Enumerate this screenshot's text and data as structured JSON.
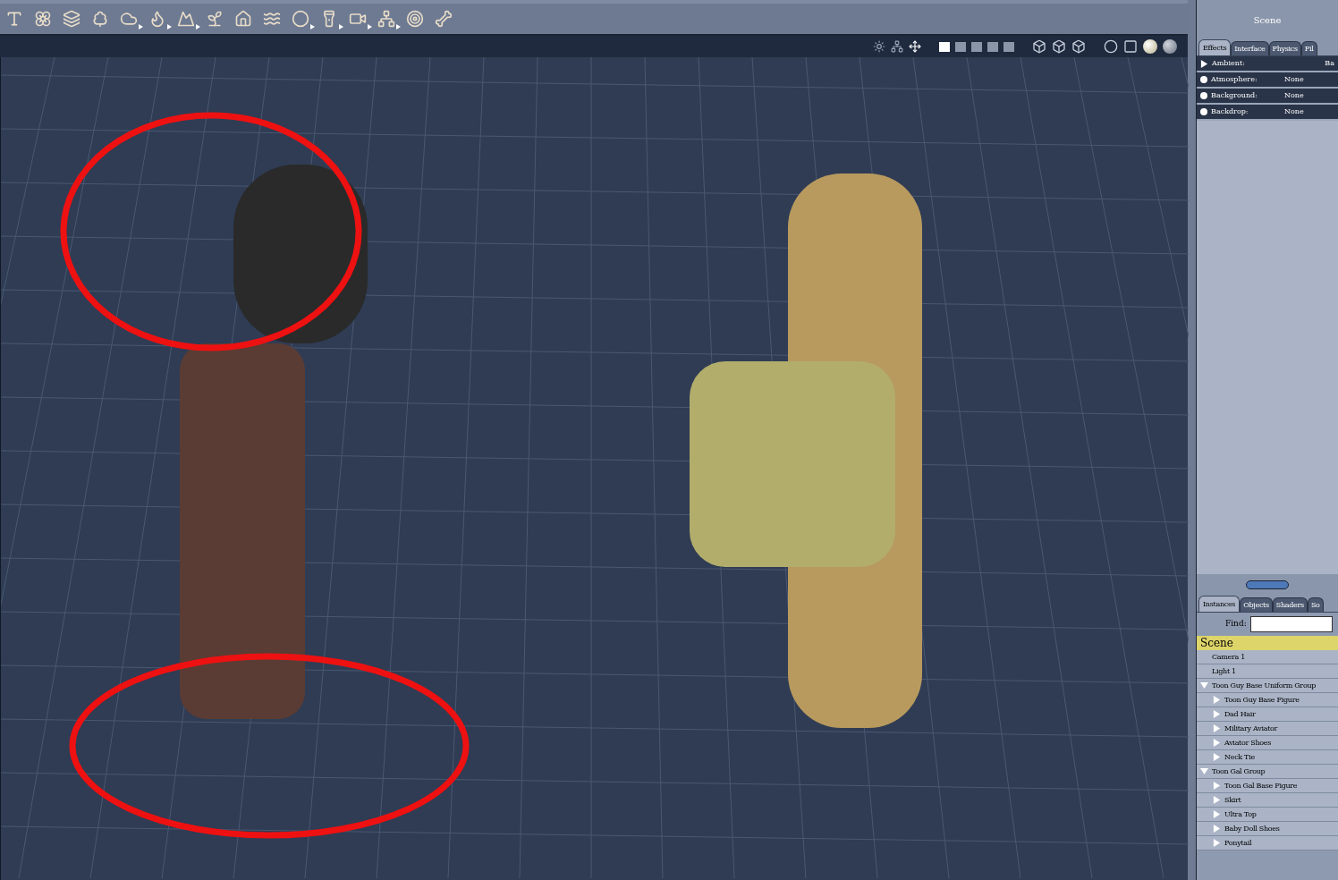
{
  "toolbar": {
    "tools": [
      {
        "menu": false
      },
      {
        "menu": false
      },
      {
        "menu": false
      },
      {
        "menu": false
      },
      {
        "menu": true
      },
      {
        "menu": true
      },
      {
        "menu": true
      },
      {
        "menu": false
      },
      {
        "menu": false
      },
      {
        "menu": false
      },
      {
        "menu": true
      },
      {
        "menu": true
      },
      {
        "menu": true
      },
      {
        "menu": true
      },
      {
        "menu": false
      },
      {
        "menu": false
      }
    ]
  },
  "viewport": {
    "layouts": [
      {
        "selected": true
      },
      {
        "selected": false
      },
      {
        "selected": false
      },
      {
        "selected": false
      },
      {
        "selected": false
      }
    ]
  },
  "properties": {
    "title": "Scene",
    "tabs": [
      {
        "label": "Effects",
        "selected": true
      },
      {
        "label": "Interface",
        "selected": false
      },
      {
        "label": "Physics",
        "selected": false
      },
      {
        "label": "Fil",
        "selected": false
      }
    ],
    "rows": [
      {
        "label": "Ambient:",
        "value": "Ba",
        "kind": "expand"
      },
      {
        "label": "Atmosphere:",
        "value": "None",
        "kind": "option"
      },
      {
        "label": "Background:",
        "value": "None",
        "kind": "option"
      },
      {
        "label": "Backdrop:",
        "value": "None",
        "kind": "option"
      }
    ]
  },
  "browser": {
    "tabs": [
      {
        "label": "Instances",
        "selected": true
      },
      {
        "label": "Objects",
        "selected": false
      },
      {
        "label": "Shaders",
        "selected": false
      },
      {
        "label": "So",
        "selected": false
      }
    ],
    "find": {
      "label": "Find:"
    },
    "root": {
      "label": "Scene",
      "selected": true
    },
    "items": [
      {
        "label": "Camera 1",
        "kind": "object",
        "selected": false
      },
      {
        "label": "Light 1",
        "kind": "object",
        "selected": false
      },
      {
        "label": "Toon Guy Base Uniform Group",
        "kind": "group",
        "expanded": true,
        "selected": false,
        "children": [
          {
            "label": "Toon Guy Base Figure",
            "kind": "group",
            "expanded": false,
            "selected": false
          },
          {
            "label": "Dad Hair",
            "kind": "group",
            "expanded": false,
            "selected": false
          },
          {
            "label": "Military Aviator",
            "kind": "group",
            "expanded": false,
            "selected": false
          },
          {
            "label": "Aviator Shoes",
            "kind": "group",
            "expanded": false,
            "selected": false
          },
          {
            "label": "Neck Tie",
            "kind": "group",
            "expanded": false,
            "selected": false
          }
        ]
      },
      {
        "label": "Toon Gal Group",
        "kind": "group",
        "expanded": true,
        "selected": false,
        "children": [
          {
            "label": "Toon Gal Base Figure",
            "kind": "group",
            "expanded": false,
            "selected": false
          },
          {
            "label": "Skirt",
            "kind": "group",
            "expanded": false,
            "selected": false
          },
          {
            "label": "Ultra Top",
            "kind": "group",
            "expanded": false,
            "selected": false
          },
          {
            "label": "Baby Doll Shoes",
            "kind": "group",
            "expanded": false,
            "selected": false
          },
          {
            "label": "Ponytail",
            "kind": "group",
            "expanded": false,
            "selected": false
          }
        ]
      }
    ]
  }
}
